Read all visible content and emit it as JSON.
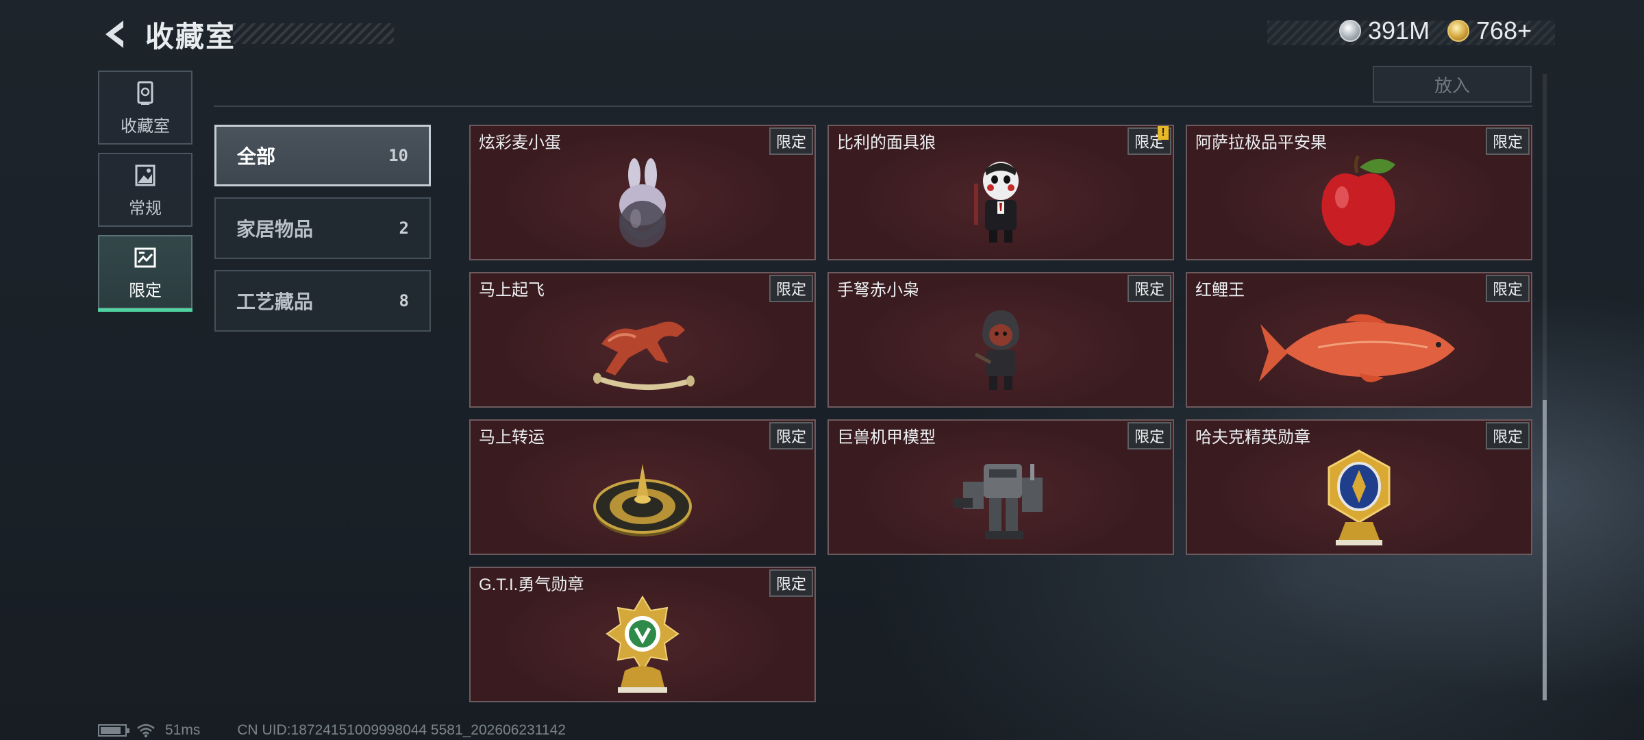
{
  "header": {
    "title": "收藏室",
    "currencies": [
      {
        "icon": "silver-coin-icon",
        "amount": "391M"
      },
      {
        "icon": "gold-coin-icon",
        "amount": "768+"
      }
    ]
  },
  "rail": {
    "items": [
      {
        "label": "收藏室",
        "icon": "vault-icon",
        "active": false
      },
      {
        "label": "常规",
        "icon": "picture-icon",
        "active": false
      },
      {
        "label": "限定",
        "icon": "limited-frame-icon",
        "active": true
      }
    ]
  },
  "top": {
    "put_label": "放入"
  },
  "filters": [
    {
      "label": "全部",
      "count": "10",
      "active": true
    },
    {
      "label": "家居物品",
      "count": "2",
      "active": false
    },
    {
      "label": "工艺藏品",
      "count": "8",
      "active": false
    }
  ],
  "items": [
    {
      "name": "炫彩麦小蛋",
      "tag": "限定",
      "icon": "rabbit-egg-figurine-icon",
      "alert": false
    },
    {
      "name": "比利的面具狼",
      "tag": "限定",
      "icon": "masked-doll-figurine-icon",
      "alert": true,
      "alert_text": "!"
    },
    {
      "name": "阿萨拉极品平安果",
      "tag": "限定",
      "icon": "red-apple-icon",
      "alert": false
    },
    {
      "name": "马上起飞",
      "tag": "限定",
      "icon": "red-horse-sculpture-icon",
      "alert": false
    },
    {
      "name": "手弩赤小枭",
      "tag": "限定",
      "icon": "hooded-figurine-icon",
      "alert": false
    },
    {
      "name": "红鲤王",
      "tag": "限定",
      "icon": "red-carp-icon",
      "alert": false
    },
    {
      "name": "马上转运",
      "tag": "限定",
      "icon": "golden-compass-disc-icon",
      "alert": false
    },
    {
      "name": "巨兽机甲模型",
      "tag": "限定",
      "icon": "mech-model-icon",
      "alert": false
    },
    {
      "name": "哈夫克精英勋章",
      "tag": "限定",
      "icon": "blue-gold-medal-icon",
      "alert": false
    },
    {
      "name": "G.T.I.勇气勋章",
      "tag": "限定",
      "icon": "green-gold-medal-icon",
      "alert": false
    }
  ],
  "scroll": {
    "position_fraction": 0.52
  },
  "footer": {
    "latency": "51ms",
    "uid": "CN UID:18724151009998044 5581_202606231142",
    "battery_fraction": 0.85
  },
  "colors": {
    "accent_green": "#4fd3a0",
    "card_bg": "#3a1c20",
    "page_bg": "#1a2128"
  }
}
